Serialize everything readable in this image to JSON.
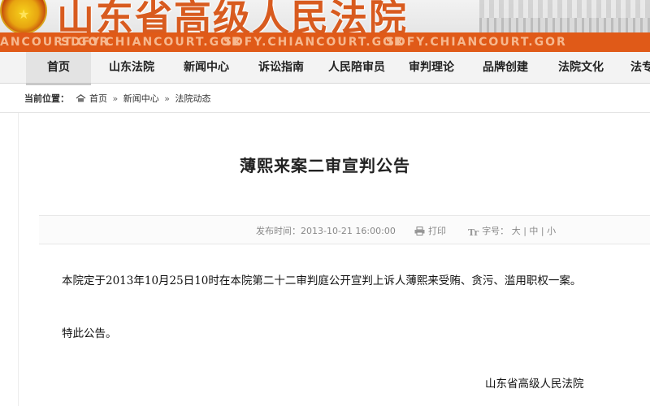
{
  "header": {
    "site_title": "山东省高级人民法院",
    "url_repeats": [
      "ANCOURT.GOR",
      "SDFY.CHIANCOURT.GOR",
      "SDFY.CHIANCOURT.GOR",
      "SDFY.CHIANCOURT.GOR"
    ]
  },
  "nav": {
    "items": [
      {
        "label": "首页"
      },
      {
        "label": "山东法院"
      },
      {
        "label": "新闻中心"
      },
      {
        "label": "诉讼指南"
      },
      {
        "label": "人民陪审员"
      },
      {
        "label": "审判理论"
      },
      {
        "label": "品牌创建"
      },
      {
        "label": "法院文化"
      },
      {
        "label": "法专"
      }
    ]
  },
  "breadcrumb": {
    "prefix": "当前位置：",
    "items": [
      "首页",
      "新闻中心",
      "法院动态"
    ],
    "separator": "»"
  },
  "article": {
    "title": "薄熙来案二审宣判公告",
    "publish_label": "发布时间：",
    "publish_time": "2013-10-21 16:00:00",
    "print_label": "打印",
    "font_size_label": "字号：",
    "size_large": "大",
    "size_medium": "中",
    "size_small": "小",
    "divider": "|",
    "body_line_1": "本院定于2013年10月25日10时在本院第二十二审判庭公开宣判上诉人薄熙来受贿、贪污、滥用职权一案。",
    "body_line_2": "特此公告。",
    "signature": "山东省高级人民法院"
  },
  "colors": {
    "brand_orange": "#e05a18",
    "title_orange": "#d85b1f",
    "nav_bg": "#f3f3f3"
  },
  "icons": {
    "emblem": "national-emblem",
    "home": "home-icon",
    "print": "printer-icon",
    "font": "font-size-icon"
  }
}
